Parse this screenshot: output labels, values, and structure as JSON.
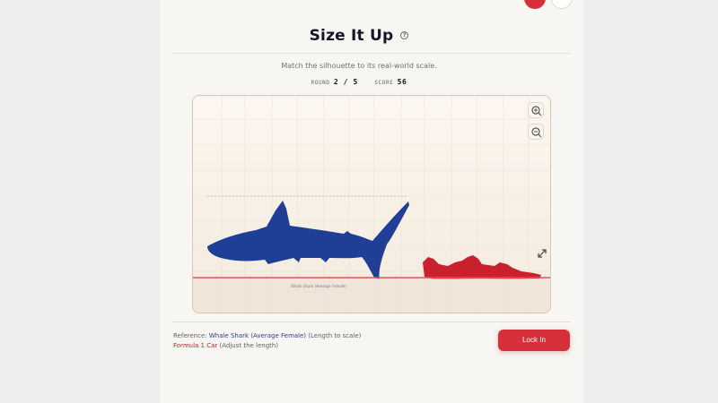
{
  "title": "Size It Up",
  "subtitle": "Match the silhouette to its real-world scale.",
  "stats": {
    "round_label": "ROUND",
    "round_value": "2 / 5",
    "score_label": "SCORE",
    "score_value": "56"
  },
  "stage": {
    "ground_label": "Whale Shark (Average Female)",
    "reference_color": "#1f3f96",
    "target_color": "#c8202d"
  },
  "footer": {
    "reference_prefix": "Reference: ",
    "reference_name": "Whale Shark (Average Female)",
    "reference_suffix": " (Length to scale)",
    "target_name": "Formula 1 Car",
    "target_suffix": " (Adjust the length)"
  },
  "lock_button": "Lock In",
  "icons": {
    "help": "help-circle-icon",
    "zoom_in": "zoom-in-icon",
    "zoom_out": "zoom-out-icon",
    "resize": "resize-diagonal-icon"
  }
}
